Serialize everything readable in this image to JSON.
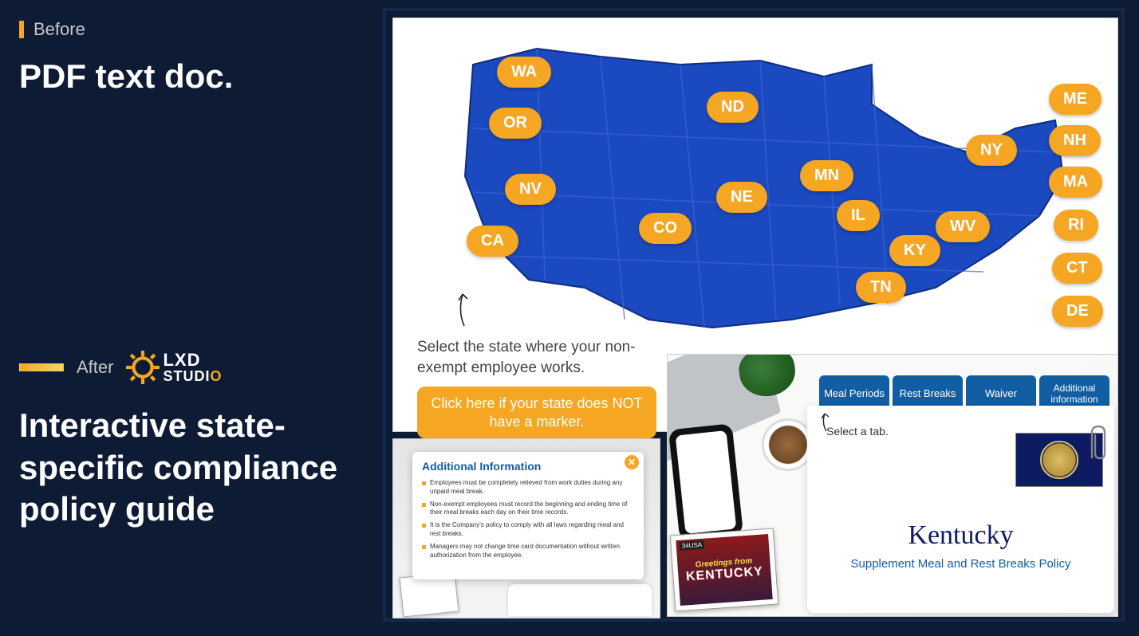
{
  "beforeLabel": "Before",
  "beforeTitle": "PDF text doc.",
  "afterLabel": "After",
  "logo": {
    "line1": "LXD",
    "line2_pre": "STUDI",
    "line2_o": "O"
  },
  "afterTitle": "Interactive state-specific compliance policy guide",
  "map": {
    "instruction": "Select the state where your non-exempt employee works.",
    "noMarkerButton": "Click here if your state does NOT have a marker.",
    "states": [
      "WA",
      "OR",
      "ND",
      "NV",
      "NE",
      "MN",
      "CO",
      "CA",
      "IL",
      "NY",
      "WV",
      "KY",
      "TN",
      "ME",
      "NH",
      "MA",
      "RI",
      "CT",
      "DE"
    ]
  },
  "addl": {
    "title": "Additional Information",
    "bullets": [
      "Employees must be completely relieved from work duties during any unpaid meal break.",
      "Non-exempt employees must record the beginning and ending time of their meal breaks each day on their time records.",
      "It is the Company's policy to comply with all laws regarding meal and rest breaks.",
      "Managers may not change time card documentation without written authorization from the employee."
    ]
  },
  "detail": {
    "tabs": [
      "Meal Periods",
      "Rest Breaks",
      "Waiver",
      "Additional information"
    ],
    "prompt": "Select a tab.",
    "stateName": "Kentucky",
    "subtitle": "Supplement Meal and Rest Breaks Policy",
    "stamp": {
      "price": "34USA",
      "greeting": "Greetings from",
      "name": "KENTUCKY"
    }
  }
}
